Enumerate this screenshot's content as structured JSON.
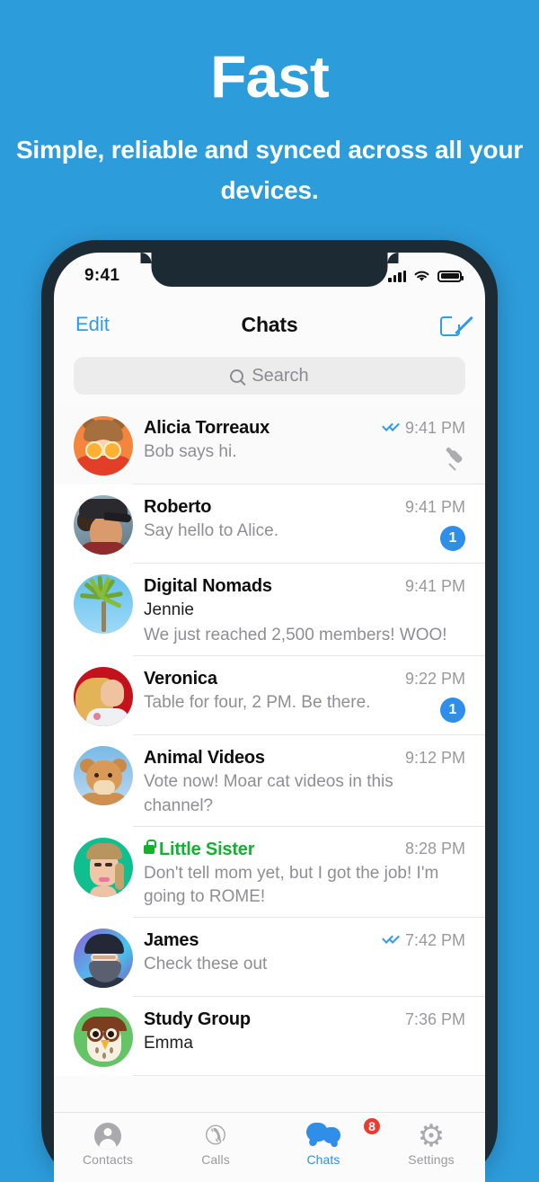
{
  "hero": {
    "title": "Fast",
    "subtitle": "Simple, reliable and synced across all your devices."
  },
  "colors": {
    "background": "#2d9cdb",
    "phone_frame": "#1c2b33",
    "accent_blue": "#2f9ceb",
    "badge_blue": "#2f8fe8",
    "badge_red": "#ec3b2e",
    "secret_green": "#12b230"
  },
  "status_bar": {
    "time": "9:41",
    "icons": [
      "cellular-icon",
      "wifi-icon",
      "battery-icon"
    ]
  },
  "nav": {
    "left_label": "Edit",
    "title": "Chats",
    "right_icon": "compose-icon"
  },
  "search": {
    "placeholder": "Search",
    "icon": "search-icon"
  },
  "chats": [
    {
      "name": "Alicia Torreaux",
      "sender": "",
      "message": "Bob says hi.",
      "time": "9:41 PM",
      "read_ticks": true,
      "badge": "",
      "pinned": true,
      "secret": false,
      "avatar": "av-alicia"
    },
    {
      "name": "Roberto",
      "sender": "",
      "message": "Say hello to Alice.",
      "time": "9:41 PM",
      "read_ticks": false,
      "badge": "1",
      "pinned": false,
      "secret": false,
      "avatar": "av-roberto"
    },
    {
      "name": "Digital Nomads",
      "sender": "Jennie",
      "message": "We just reached 2,500 members! WOO!",
      "time": "9:41 PM",
      "read_ticks": false,
      "badge": "",
      "pinned": false,
      "secret": false,
      "avatar": "av-nomads"
    },
    {
      "name": "Veronica",
      "sender": "",
      "message": "Table for four, 2 PM. Be there.",
      "time": "9:22 PM",
      "read_ticks": false,
      "badge": "1",
      "pinned": false,
      "secret": false,
      "avatar": "av-veronica"
    },
    {
      "name": "Animal Videos",
      "sender": "",
      "message": "Vote now! Moar cat videos in this channel?",
      "time": "9:12 PM",
      "read_ticks": false,
      "badge": "",
      "pinned": false,
      "secret": false,
      "avatar": "av-animal"
    },
    {
      "name": "Little Sister",
      "sender": "",
      "message": "Don't tell mom yet, but I got the job! I'm going to ROME!",
      "time": "8:28 PM",
      "read_ticks": false,
      "badge": "",
      "pinned": false,
      "secret": true,
      "avatar": "av-sister"
    },
    {
      "name": "James",
      "sender": "",
      "message": "Check these out",
      "time": "7:42 PM",
      "read_ticks": true,
      "badge": "",
      "pinned": false,
      "secret": false,
      "avatar": "av-james"
    },
    {
      "name": "Study Group",
      "sender": "Emma",
      "message": "",
      "time": "7:36 PM",
      "read_ticks": false,
      "badge": "",
      "pinned": false,
      "secret": false,
      "avatar": "av-study"
    }
  ],
  "tabs": [
    {
      "label": "Contacts",
      "icon": "contacts-icon",
      "active": false,
      "badge": ""
    },
    {
      "label": "Calls",
      "icon": "phone-icon",
      "active": false,
      "badge": ""
    },
    {
      "label": "Chats",
      "icon": "chats-icon",
      "active": true,
      "badge": "8"
    },
    {
      "label": "Settings",
      "icon": "gear-icon",
      "active": false,
      "badge": ""
    }
  ]
}
